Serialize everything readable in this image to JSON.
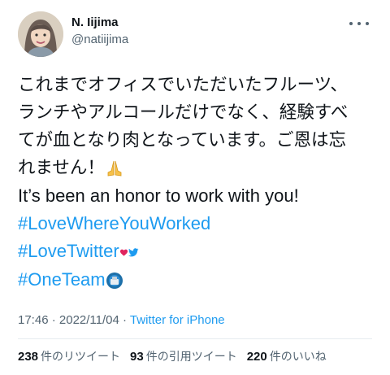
{
  "author": {
    "display_name": "N. Iijima",
    "handle": "@natiijima"
  },
  "tweet": {
    "lines_ja": [
      "これまでオフィスでいただいたフルーツ、",
      "ランチやアルコールだけでなく、経験すべ",
      "てが血となり肉となっています。ご恩は忘",
      "れません！"
    ],
    "line_en": "It’s been an honor to work with you!",
    "hashtags": [
      "#LoveWhereYouWorked",
      "#LoveTwitter",
      "#OneTeam"
    ]
  },
  "meta": {
    "time": "17:46",
    "sep1": " · ",
    "date": "2022/11/04",
    "sep2": " · ",
    "source": "Twitter for iPhone"
  },
  "stats": {
    "retweets": {
      "count": "238",
      "label": "件のリツイート"
    },
    "quotes": {
      "count": "93",
      "label": "件の引用ツイート"
    },
    "likes": {
      "count": "220",
      "label": "件のいいね"
    }
  },
  "icons": [
    "avatar",
    "more-icon",
    "praying-hands-icon",
    "heart-icon",
    "bird-icon",
    "team-badge-icon"
  ],
  "colors": {
    "link": "#1d9bf0",
    "text": "#0f1419",
    "secondary": "#536471",
    "heart": "#e0245e"
  }
}
